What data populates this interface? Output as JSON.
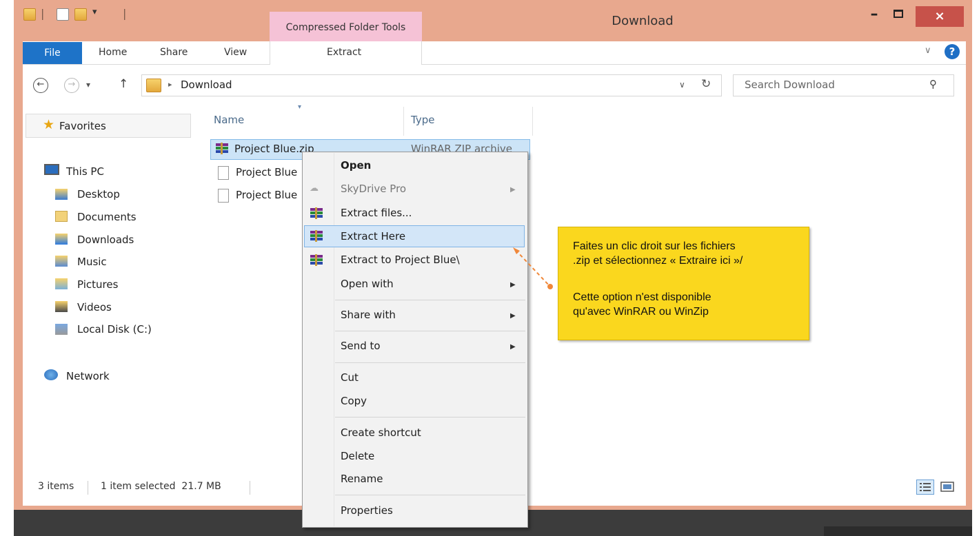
{
  "window": {
    "title": "Download",
    "contextual_tab_group": "Compressed Folder Tools",
    "controls": {
      "minimize": "–",
      "close": "×"
    }
  },
  "ribbon": {
    "tabs": [
      "File",
      "Home",
      "Share",
      "View"
    ],
    "contextual_tab": "Extract",
    "collapse_glyph": "∨",
    "help": "?"
  },
  "address": {
    "path_segments": [
      "Download"
    ],
    "separator": "▸",
    "dropdown_glyph": "∨",
    "refresh_glyph": "↻",
    "search_placeholder": "Search Download",
    "search_icon": "⚲"
  },
  "nav": {
    "back": "←",
    "forward": "→",
    "recent": "▾",
    "up": "↑",
    "favorites": "Favorites",
    "this_pc": "This PC",
    "this_pc_items": [
      "Desktop",
      "Documents",
      "Downloads",
      "Music",
      "Pictures",
      "Videos",
      "Local Disk (C:)"
    ],
    "network": "Network"
  },
  "file_list": {
    "columns": [
      "Name",
      "Type"
    ],
    "sort_arrow": "▾",
    "rows": [
      {
        "name": "Project Blue.zip",
        "type": "WinRAR ZIP archive",
        "icon": "winrar-icon",
        "selected": true
      },
      {
        "name": "Project Blue",
        "type": "",
        "icon": "file-icon",
        "selected": false
      },
      {
        "name": "Project Blue",
        "type": "",
        "icon": "file-icon",
        "selected": false
      }
    ]
  },
  "context_menu": {
    "open": "Open",
    "skydrive": "SkyDrive Pro",
    "extract_files": "Extract files...",
    "extract_here": "Extract Here",
    "extract_to": "Extract to Project Blue\\",
    "open_with": "Open with",
    "share_with": "Share with",
    "send_to": "Send to",
    "cut": "Cut",
    "copy": "Copy",
    "create_shortcut": "Create shortcut",
    "delete": "Delete",
    "rename": "Rename",
    "properties": "Properties",
    "submenu_arrow": "▶"
  },
  "callout": {
    "line1": "Faites un clic droit sur les fichiers",
    "line2": ".zip et sélectionnez « Extraire ici »/",
    "line3": "Cette option n'est disponible",
    "line4": "qu'avec WinRAR ou WinZip"
  },
  "status_bar": {
    "item_count": "3 items",
    "selection": "1 item selected  21.7 MB"
  },
  "colors": {
    "title_bar": "#e8a88e",
    "file_tab": "#1e73c8",
    "contextual_tab": "#f5c2d6",
    "close_button": "#c7524a",
    "callout": "#fad71e",
    "callout_arrow": "#f0883a",
    "selection": "#cce4f7"
  }
}
